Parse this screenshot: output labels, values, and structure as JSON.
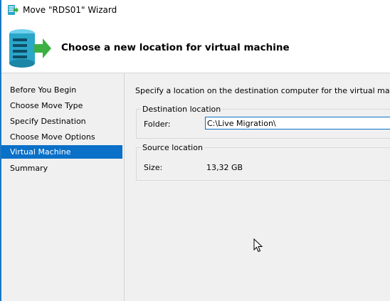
{
  "window": {
    "title": "Move \"RDS01\" Wizard"
  },
  "header": {
    "title": "Choose a new location for virtual machine"
  },
  "sidebar": {
    "items": [
      {
        "label": "Before You Begin",
        "active": false
      },
      {
        "label": "Choose Move Type",
        "active": false
      },
      {
        "label": "Specify Destination",
        "active": false
      },
      {
        "label": "Choose Move Options",
        "active": false
      },
      {
        "label": "Virtual Machine",
        "active": true
      },
      {
        "label": "Summary",
        "active": false
      }
    ]
  },
  "main": {
    "intro": "Specify a location on the destination computer for the virtual machine's ite",
    "destination": {
      "group_label": "Destination location",
      "folder_label": "Folder:",
      "folder_value": "C:\\Live Migration\\"
    },
    "source": {
      "group_label": "Source location",
      "size_label": "Size:",
      "size_value": "13,32 GB"
    }
  },
  "colors": {
    "accent": "#0a70c8",
    "window_edge": "#1a78c2",
    "icon_green": "#3cb043",
    "icon_teal": "#2aa6c9"
  },
  "icons": {
    "title": "wizard-icon",
    "header": "server-move-icon",
    "pointer": "mouse-cursor-icon"
  }
}
